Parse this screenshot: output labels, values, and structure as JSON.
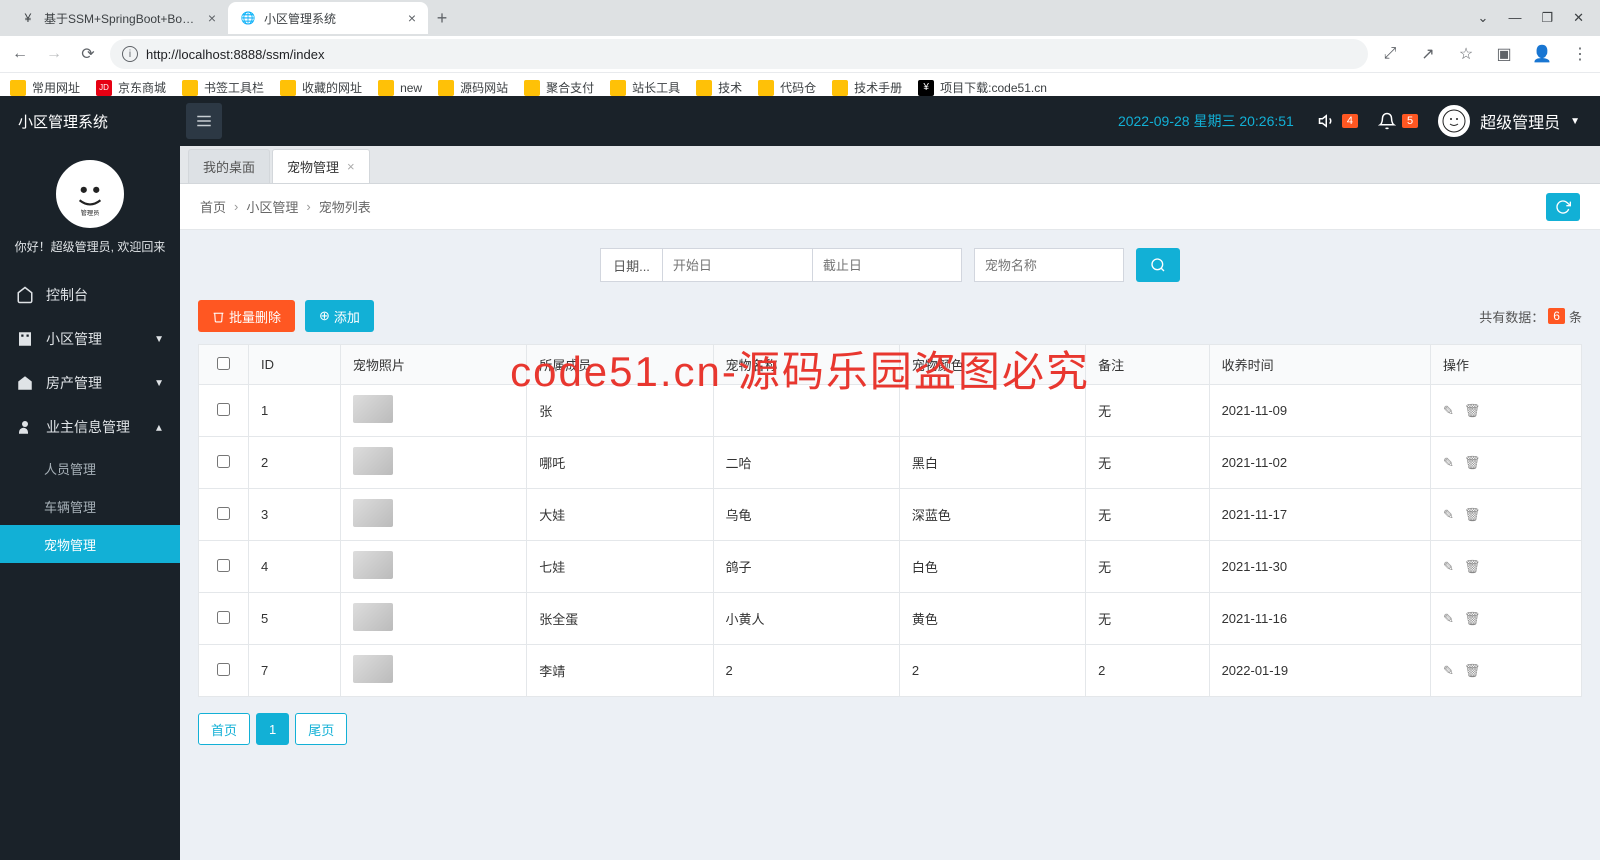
{
  "browser": {
    "tabs": [
      {
        "title": "基于SSM+SpringBoot+BootSt",
        "active": false
      },
      {
        "title": "小区管理系统",
        "active": true
      }
    ],
    "url": "http://localhost:8888/ssm/index",
    "window_controls": {
      "min": "—",
      "max": "❐",
      "close": "✕",
      "dropdown": "⌄"
    },
    "bookmarks": [
      "常用网址",
      "京东商城",
      "书签工具栏",
      "收藏的网址",
      "new",
      "源码网站",
      "聚合支付",
      "站长工具",
      "技术",
      "代码仓",
      "技术手册",
      "项目下载:code51.cn"
    ]
  },
  "topbar": {
    "brand": "小区管理系统",
    "datetime": "2022-09-28  星期三  20:26:51",
    "noti1": "4",
    "noti2": "5",
    "username": "超级管理员"
  },
  "sidebar": {
    "welcome": "你好！超级管理员, 欢迎回来",
    "items": [
      {
        "icon": "home",
        "label": "控制台",
        "expandable": false
      },
      {
        "icon": "building",
        "label": "小区管理",
        "expandable": true
      },
      {
        "icon": "house",
        "label": "房产管理",
        "expandable": true
      },
      {
        "icon": "user",
        "label": "业主信息管理",
        "expandable": true,
        "expanded": true,
        "children": [
          {
            "label": "人员管理",
            "active": false
          },
          {
            "label": "车辆管理",
            "active": false
          },
          {
            "label": "宠物管理",
            "active": true
          }
        ]
      }
    ]
  },
  "page_tabs": [
    {
      "label": "我的桌面",
      "active": false,
      "closable": false
    },
    {
      "label": "宠物管理",
      "active": true,
      "closable": true
    }
  ],
  "breadcrumb": [
    "首页",
    "小区管理",
    "宠物列表"
  ],
  "search": {
    "date_label": "日期...",
    "start_ph": "开始日",
    "end_ph": "截止日",
    "name_ph": "宠物名称"
  },
  "actions": {
    "delete": "批量删除",
    "add": "添加",
    "count_prefix": "共有数据：",
    "count": "6",
    "count_suffix": "条"
  },
  "table": {
    "headers": [
      "",
      "ID",
      "宠物照片",
      "所属成员",
      "宠物名称",
      "宠物颜色",
      "备注",
      "收养时间",
      "操作"
    ],
    "rows": [
      {
        "id": "1",
        "member": "张",
        "name": "",
        "color": "",
        "remark": "无",
        "date": "2021-11-09"
      },
      {
        "id": "2",
        "member": "哪吒",
        "name": "二哈",
        "color": "黑白",
        "remark": "无",
        "date": "2021-11-02"
      },
      {
        "id": "3",
        "member": "大娃",
        "name": "乌龟",
        "color": "深蓝色",
        "remark": "无",
        "date": "2021-11-17"
      },
      {
        "id": "4",
        "member": "七娃",
        "name": "鸽子",
        "color": "白色",
        "remark": "无",
        "date": "2021-11-30"
      },
      {
        "id": "5",
        "member": "张全蛋",
        "name": "小黄人",
        "color": "黄色",
        "remark": "无",
        "date": "2021-11-16"
      },
      {
        "id": "7",
        "member": "李靖",
        "name": "2",
        "color": "2",
        "remark": "2",
        "date": "2022-01-19"
      }
    ]
  },
  "pagination": {
    "first": "首页",
    "page1": "1",
    "last": "尾页"
  },
  "watermark": "code51.cn-源码乐园盗图必究"
}
